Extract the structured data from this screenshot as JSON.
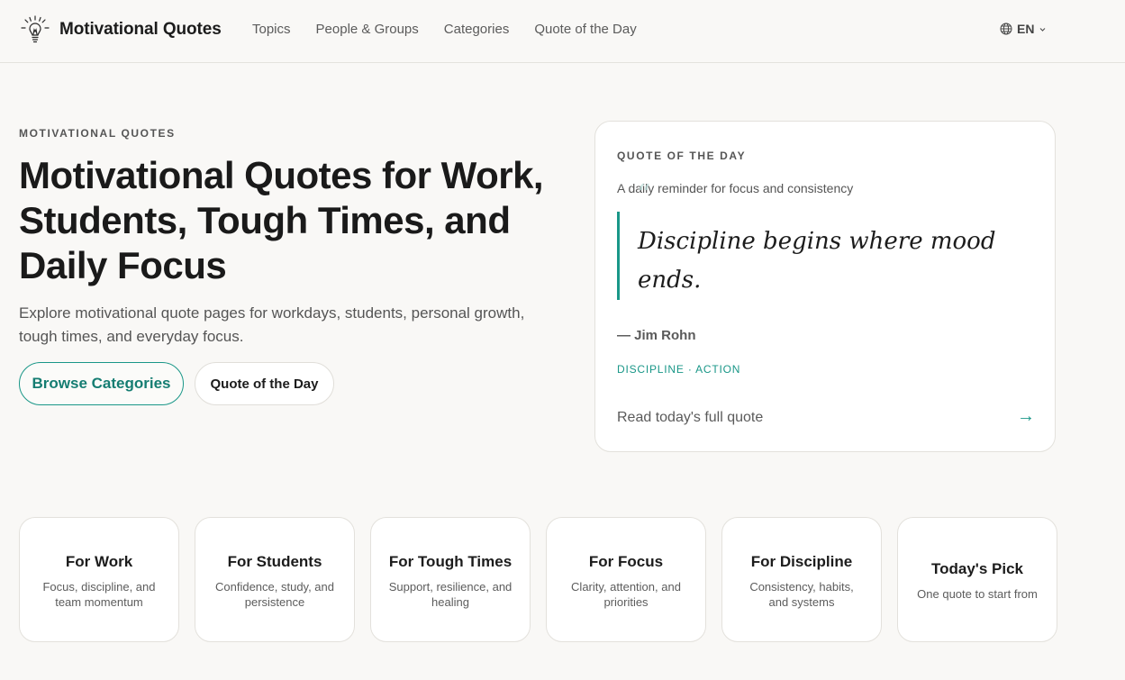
{
  "brand": {
    "name": "Motivational Quotes",
    "icon": "lightbulb-icon"
  },
  "nav": {
    "items": [
      {
        "label": "Topics"
      },
      {
        "label": "People & Groups"
      },
      {
        "label": "Categories"
      },
      {
        "label": "Quote of the Day"
      }
    ]
  },
  "language": {
    "label": "EN",
    "icon": "globe-icon"
  },
  "hero": {
    "eyebrow": "MOTIVATIONAL QUOTES",
    "title": "Motivational Quotes for Work, Students, Tough Times, and Daily Focus",
    "subtitle": "Explore motivational quote pages for workdays, students, personal growth, tough times, and everyday focus.",
    "primary_button": "Browse Categories",
    "secondary_button": "Quote of the Day"
  },
  "qotd": {
    "label": "QUOTE OF THE DAY",
    "description": "A daily reminder for focus and consistency",
    "quote": "Discipline begins where mood ends.",
    "author": "— Jim Rohn",
    "tags": "DISCIPLINE · ACTION",
    "link": "Read today's full quote",
    "arrow": "→"
  },
  "categories": [
    {
      "title": "For Work",
      "desc": "Focus, discipline, and team momentum"
    },
    {
      "title": "For Students",
      "desc": "Confidence, study, and persistence"
    },
    {
      "title": "For Tough Times",
      "desc": "Support, resilience, and healing"
    },
    {
      "title": "For Focus",
      "desc": "Clarity, attention, and priorities"
    },
    {
      "title": "For Discipline",
      "desc": "Consistency, habits, and systems"
    },
    {
      "title": "Today's Pick",
      "desc": "One quote to start from"
    }
  ],
  "colors": {
    "accent": "#1a9788",
    "background": "#f9f8f6",
    "card": "#ffffff"
  }
}
